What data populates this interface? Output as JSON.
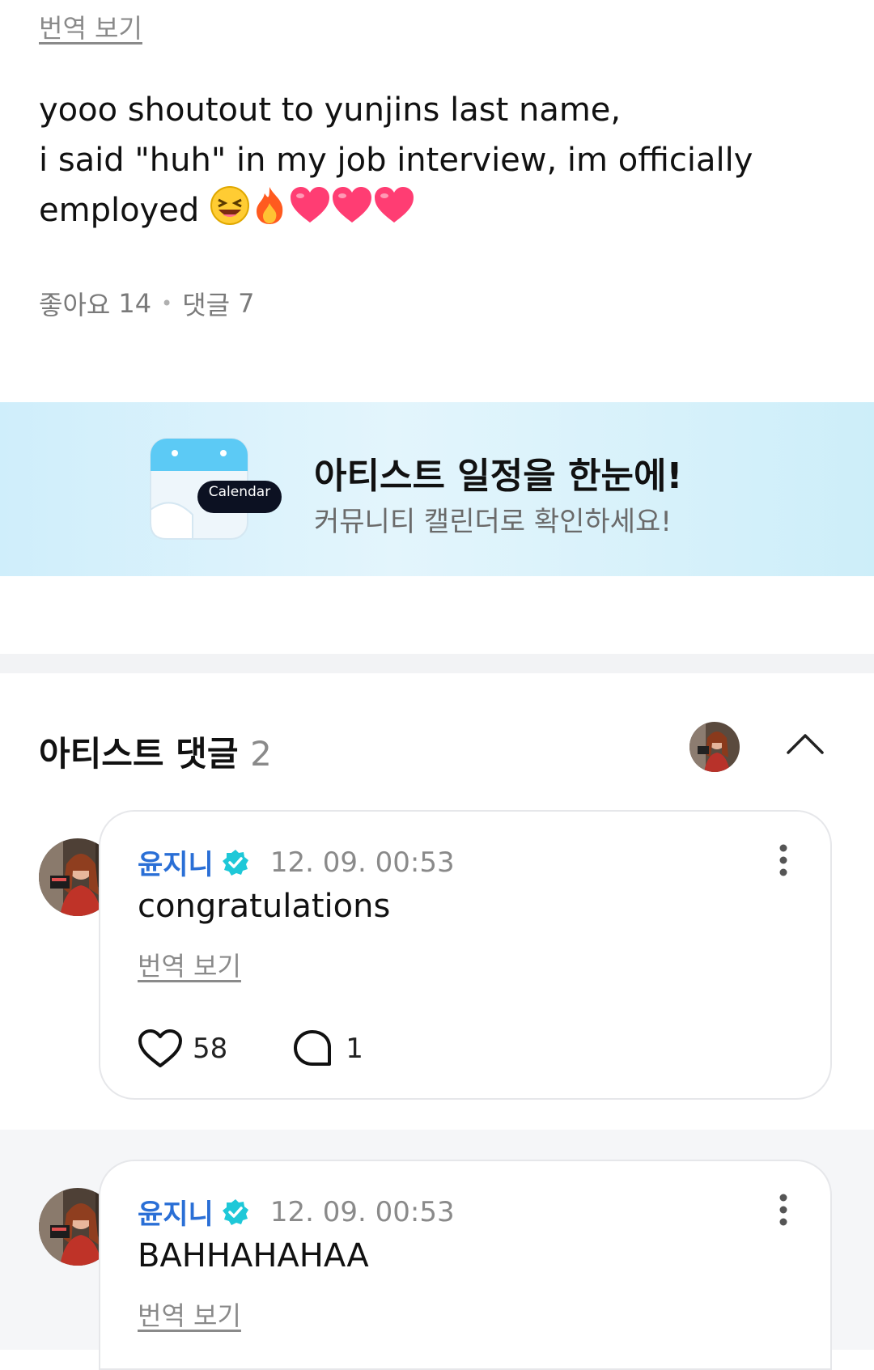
{
  "post": {
    "translate_label": "번역 보기",
    "lines": [
      "yooo shoutout to yunjins last name,",
      "i said \"huh\" in my job interview, im officially",
      "employed"
    ],
    "emojis": [
      "laughing-emoji",
      "fire-emoji",
      "heart-emoji",
      "heart-emoji",
      "heart-emoji"
    ],
    "likes_label": "좋아요",
    "likes_count": "14",
    "comments_label": "댓글",
    "comments_count": "7"
  },
  "banner": {
    "title": "아티스트 일정을 한눈에!",
    "subtitle": "커뮤니티 캘린더로 확인하세요!",
    "icon_badge": "Calendar"
  },
  "artist_comments": {
    "title": "아티스트 댓글",
    "count": "2",
    "comments": [
      {
        "author": "윤지니",
        "time": "12. 09. 00:53",
        "text": "congratulations",
        "translate_label": "번역 보기",
        "likes": "58",
        "replies": "1"
      },
      {
        "author": "윤지니",
        "time": "12. 09. 00:53",
        "text": "BAHHAHAHAA",
        "translate_label": "번역 보기"
      }
    ]
  },
  "colors": {
    "accent": "#2a6fd6",
    "verified": "#1ec8d8",
    "banner_bg": "#d8f1fb",
    "heart": "#ff3d73"
  }
}
